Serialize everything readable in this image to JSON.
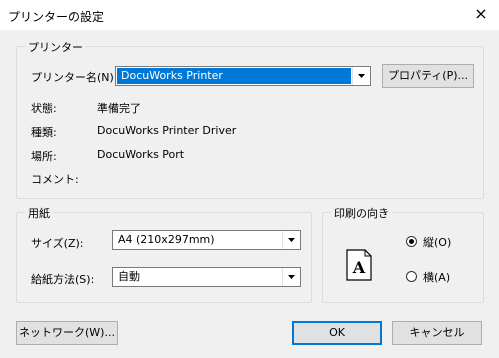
{
  "window": {
    "title": "プリンターの設定",
    "close_symbol": "×"
  },
  "printer_group": {
    "title": "プリンター",
    "name_label_text": "プリンター名",
    "name_label_key": "(N):",
    "name_value": "DocuWorks Printer",
    "properties_button": "プロパティ(P)...",
    "status_label": "状態:",
    "status_value": "準備完了",
    "type_label": "種類:",
    "type_value": "DocuWorks Printer Driver",
    "location_label": "場所:",
    "location_value": "DocuWorks Port",
    "comment_label": "コメント:",
    "comment_value": ""
  },
  "paper_group": {
    "title": "用紙",
    "size_label_text": "サイズ",
    "size_label_key": "(Z):",
    "size_value": "A4 (210x297mm)",
    "source_label_text": "給紙方法",
    "source_label_key": "(S):",
    "source_value": "自動"
  },
  "orientation_group": {
    "title": "印刷の向き",
    "portrait_label": "縦(O)",
    "landscape_label": "横(A)",
    "selected": "portrait",
    "preview_letter": "A"
  },
  "footer": {
    "network_button": "ネットワーク(W)...",
    "ok_button": "OK",
    "cancel_button": "キャンセル"
  }
}
